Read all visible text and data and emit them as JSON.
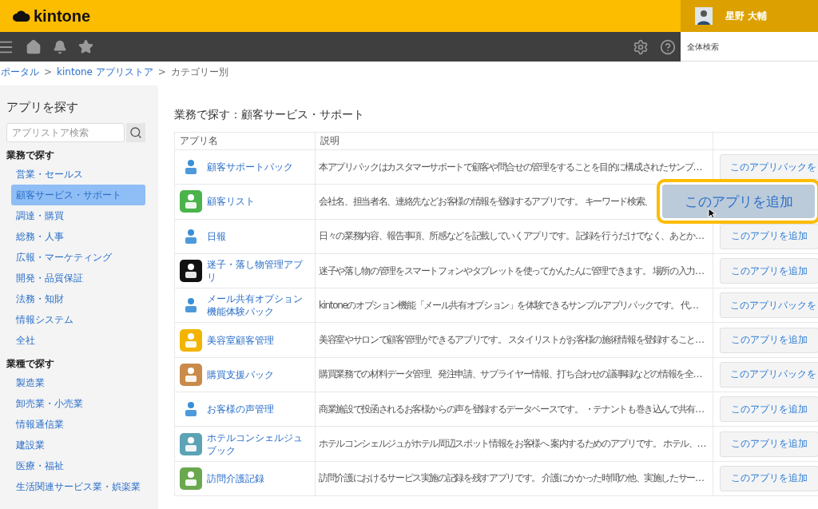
{
  "header": {
    "logo": "kintone",
    "user": {
      "name": "星野 大輔"
    }
  },
  "navbar": {
    "search": {
      "placeholder": "全体検索"
    }
  },
  "breadcrumb": {
    "separator": ">",
    "items": [
      {
        "label": "ポータル",
        "link": true
      },
      {
        "label": "kintone アプリストア",
        "link": true
      },
      {
        "label": "カテゴリー別",
        "link": false
      }
    ]
  },
  "sidebar": {
    "title": "アプリを探す",
    "search": {
      "placeholder": "アプリストア検索"
    },
    "sections": [
      {
        "heading": "業務で探す",
        "items": [
          {
            "label": "営業・セールス",
            "selected": false
          },
          {
            "label": "顧客サービス・サポート",
            "selected": true
          },
          {
            "label": "調達・購買",
            "selected": false
          },
          {
            "label": "総務・人事",
            "selected": false
          },
          {
            "label": "広報・マーケティング",
            "selected": false
          },
          {
            "label": "開発・品質保証",
            "selected": false
          },
          {
            "label": "法務・知財",
            "selected": false
          },
          {
            "label": "情報システム",
            "selected": false
          },
          {
            "label": "全社",
            "selected": false
          }
        ]
      },
      {
        "heading": "業種で探す",
        "items": [
          {
            "label": "製造業",
            "selected": false
          },
          {
            "label": "卸売業・小売業",
            "selected": false
          },
          {
            "label": "情報通信業",
            "selected": false
          },
          {
            "label": "建設業",
            "selected": false
          },
          {
            "label": "医療・福祉",
            "selected": false
          },
          {
            "label": "生活関連サービス業・娯楽業",
            "selected": false
          }
        ]
      }
    ]
  },
  "main": {
    "title": "業務で探す：顧客サービス・サポート",
    "table": {
      "columns": [
        "アプリ名",
        "説明"
      ],
      "rows": [
        {
          "name": "顧客サポートパック",
          "description": "本アプリパックはカスタマーサポートで顧客や問合せの管理をすることを目的に構成されたサンプ…",
          "button": "このアプリパックを"
        },
        {
          "name": "顧客リスト",
          "description": "会社名、担当者名、連絡先などお客様の情報を登録するアプリです。 キーワード検索、"
        },
        {
          "name": "日報",
          "description": "日々の業務内容、報告事項、所感などを記載していくアプリです。 記録を行うだけでなく、あとか…",
          "button": "このアプリを追加"
        },
        {
          "name": "迷子・落し物管理アプリ",
          "description": "迷子や落し物の管理をスマートフォンやタブレットを使ってかんたんに管理できます。 場所の入力…",
          "button": "このアプリを追加"
        },
        {
          "name": "メール共有オプション機能体験パック",
          "description": "kintoneのオプション機能「メール共有オプション」を体験できるサンプルアプリパックです。 代…",
          "button": "このアプリパックを"
        },
        {
          "name": "美容室顧客管理",
          "description": "美容室やサロンで顧客管理ができるアプリです。 スタイリストがお客様の施術情報を登録すること…",
          "button": "このアプリを追加"
        },
        {
          "name": "購買支援パック",
          "description": "購買業務での材料データ管理、発注申請、サプライヤー情報、打ち合わせの議事録などの情報を全…",
          "button": "このアプリパックを"
        },
        {
          "name": "お客様の声管理",
          "description": "商業施設で投函されるお客様からの声を登録するデータベースです。 ・テナントも巻き込んで共有…",
          "button": "このアプリを追加"
        },
        {
          "name": "ホテルコンシェルジュブック",
          "description": "ホテルコンシェルジュがホテル周辺スポット情報をお客様へ 案内するためのアプリです。 ホテル、…",
          "button": "このアプリを追加"
        },
        {
          "name": "訪問介護記録",
          "description": "訪問介護におけるサービス実施の記録を残すアプリです。 介護にかかった時間の他、実施したサー…",
          "button": "このアプリを追加"
        }
      ]
    },
    "callout": {
      "label": "このアプリを追加"
    }
  }
}
